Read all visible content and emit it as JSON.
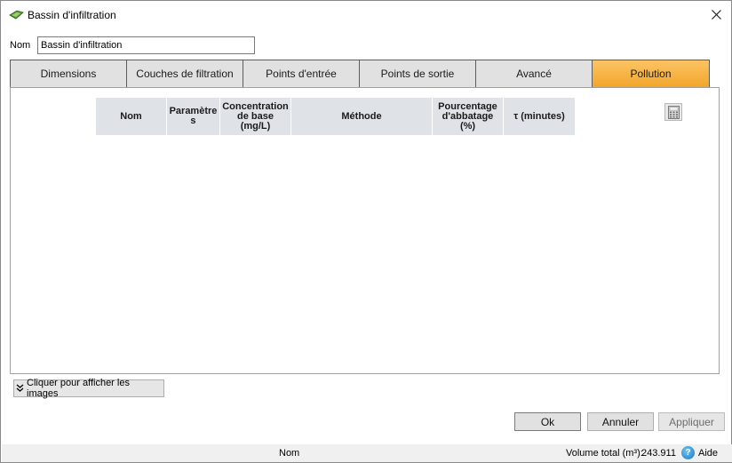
{
  "window": {
    "title": "Bassin d'infiltration",
    "icon": "infiltration-basin-icon"
  },
  "form": {
    "name_label": "Nom",
    "name_value": "Bassin d'infiltration"
  },
  "tabs": [
    {
      "label": "Dimensions"
    },
    {
      "label": "Couches de filtration"
    },
    {
      "label": "Points d'entrée"
    },
    {
      "label": "Points de sortie"
    },
    {
      "label": "Avancé"
    },
    {
      "label": "Pollution",
      "active": true
    }
  ],
  "grid": {
    "columns": [
      {
        "label": "Nom"
      },
      {
        "label": "Paramètre\ns"
      },
      {
        "label": "Concentration\nde base\n(mg/L)"
      },
      {
        "label": "Méthode"
      },
      {
        "label": "Pourcentage\nd'abbatage\n(%)"
      },
      {
        "label": "τ (minutes)"
      }
    ],
    "rows": []
  },
  "toolbar": {
    "calculator_icon": "calculator-icon"
  },
  "images_button": {
    "label": "Cliquer pour afficher les images"
  },
  "dialog_buttons": {
    "ok": "Ok",
    "cancel": "Annuler",
    "apply": "Appliquer"
  },
  "status": {
    "name": "Nom",
    "volume_label": "Volume total (m³):",
    "volume_value": "243.911",
    "help": "Aide"
  },
  "colors": {
    "active_tab_top": "#fcc464",
    "active_tab_bottom": "#f2a52b",
    "grid_header_bg": "#dfe3e8"
  }
}
